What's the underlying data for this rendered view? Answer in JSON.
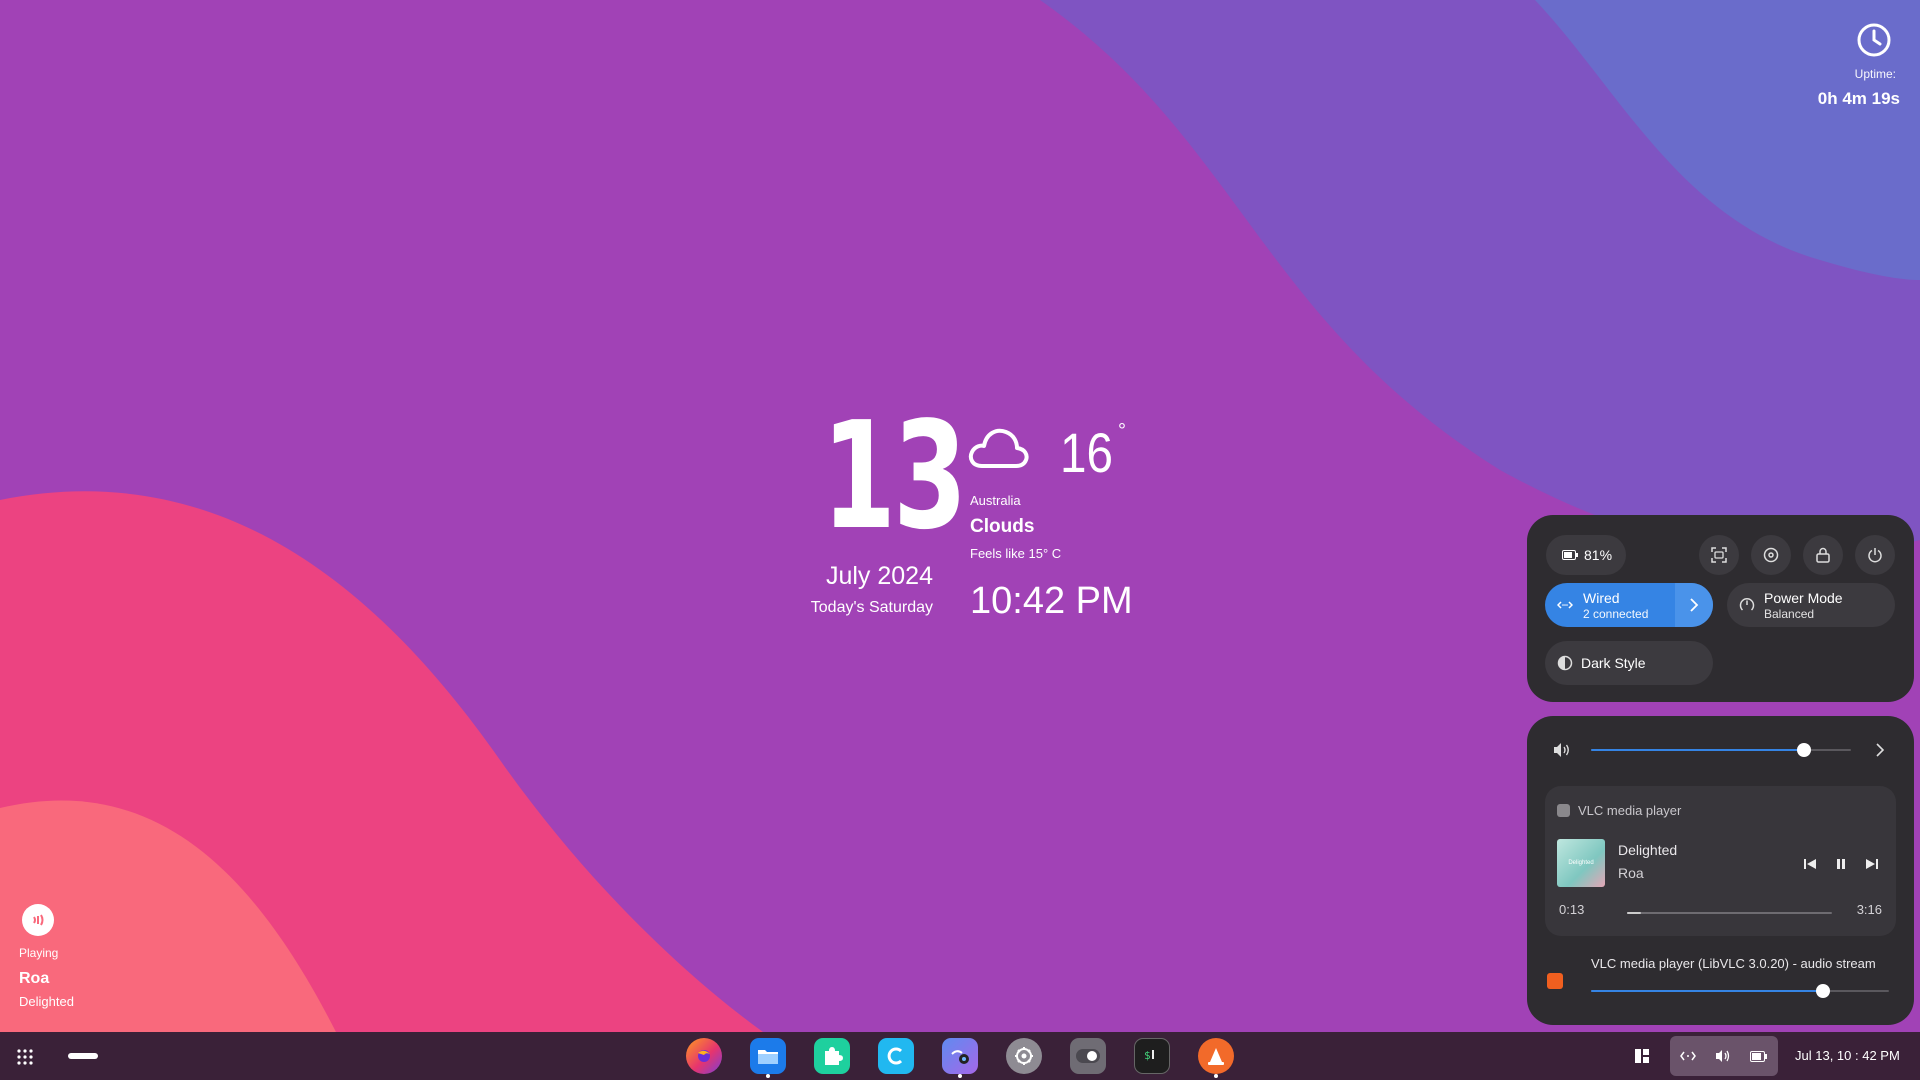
{
  "uptime": {
    "label": "Uptime:",
    "value": "0h 4m 19s"
  },
  "clock_widget": {
    "day": "13",
    "month_year": "July 2024",
    "weekday": "Today's Saturday",
    "temperature": "16",
    "degree_symbol": "°",
    "location": "Australia",
    "condition": "Clouds",
    "feels_like": "Feels like 15° C",
    "time": "10:42 PM"
  },
  "now_playing": {
    "status": "Playing",
    "artist": "Roa",
    "song": "Delighted"
  },
  "quick_settings": {
    "battery": "81%",
    "wired_label": "Wired",
    "wired_sub": "2 connected",
    "power_label": "Power Mode",
    "power_sub": "Balanced",
    "dark_label": "Dark Style"
  },
  "audio": {
    "volume_fraction": 0.82,
    "player_app": "VLC media player",
    "track_title": "Delighted",
    "track_artist": "Roa",
    "cover_text": "Delighted",
    "time_current": "0:13",
    "time_total": "3:16",
    "progress_fraction": 0.07,
    "stream_label": "VLC media player (LibVLC 3.0.20) - audio stream",
    "stream_volume_fraction": 0.78
  },
  "taskbar": {
    "clock": "Jul 13, 10 : 42 PM",
    "apps": [
      "firefox",
      "files",
      "extensions",
      "code-editor",
      "image-viewer",
      "settings",
      "toggle",
      "terminal",
      "vlc"
    ]
  },
  "colors": {
    "accent": "#3584e4",
    "panel": "#2e2c30",
    "taskbar": "#3a2138"
  }
}
